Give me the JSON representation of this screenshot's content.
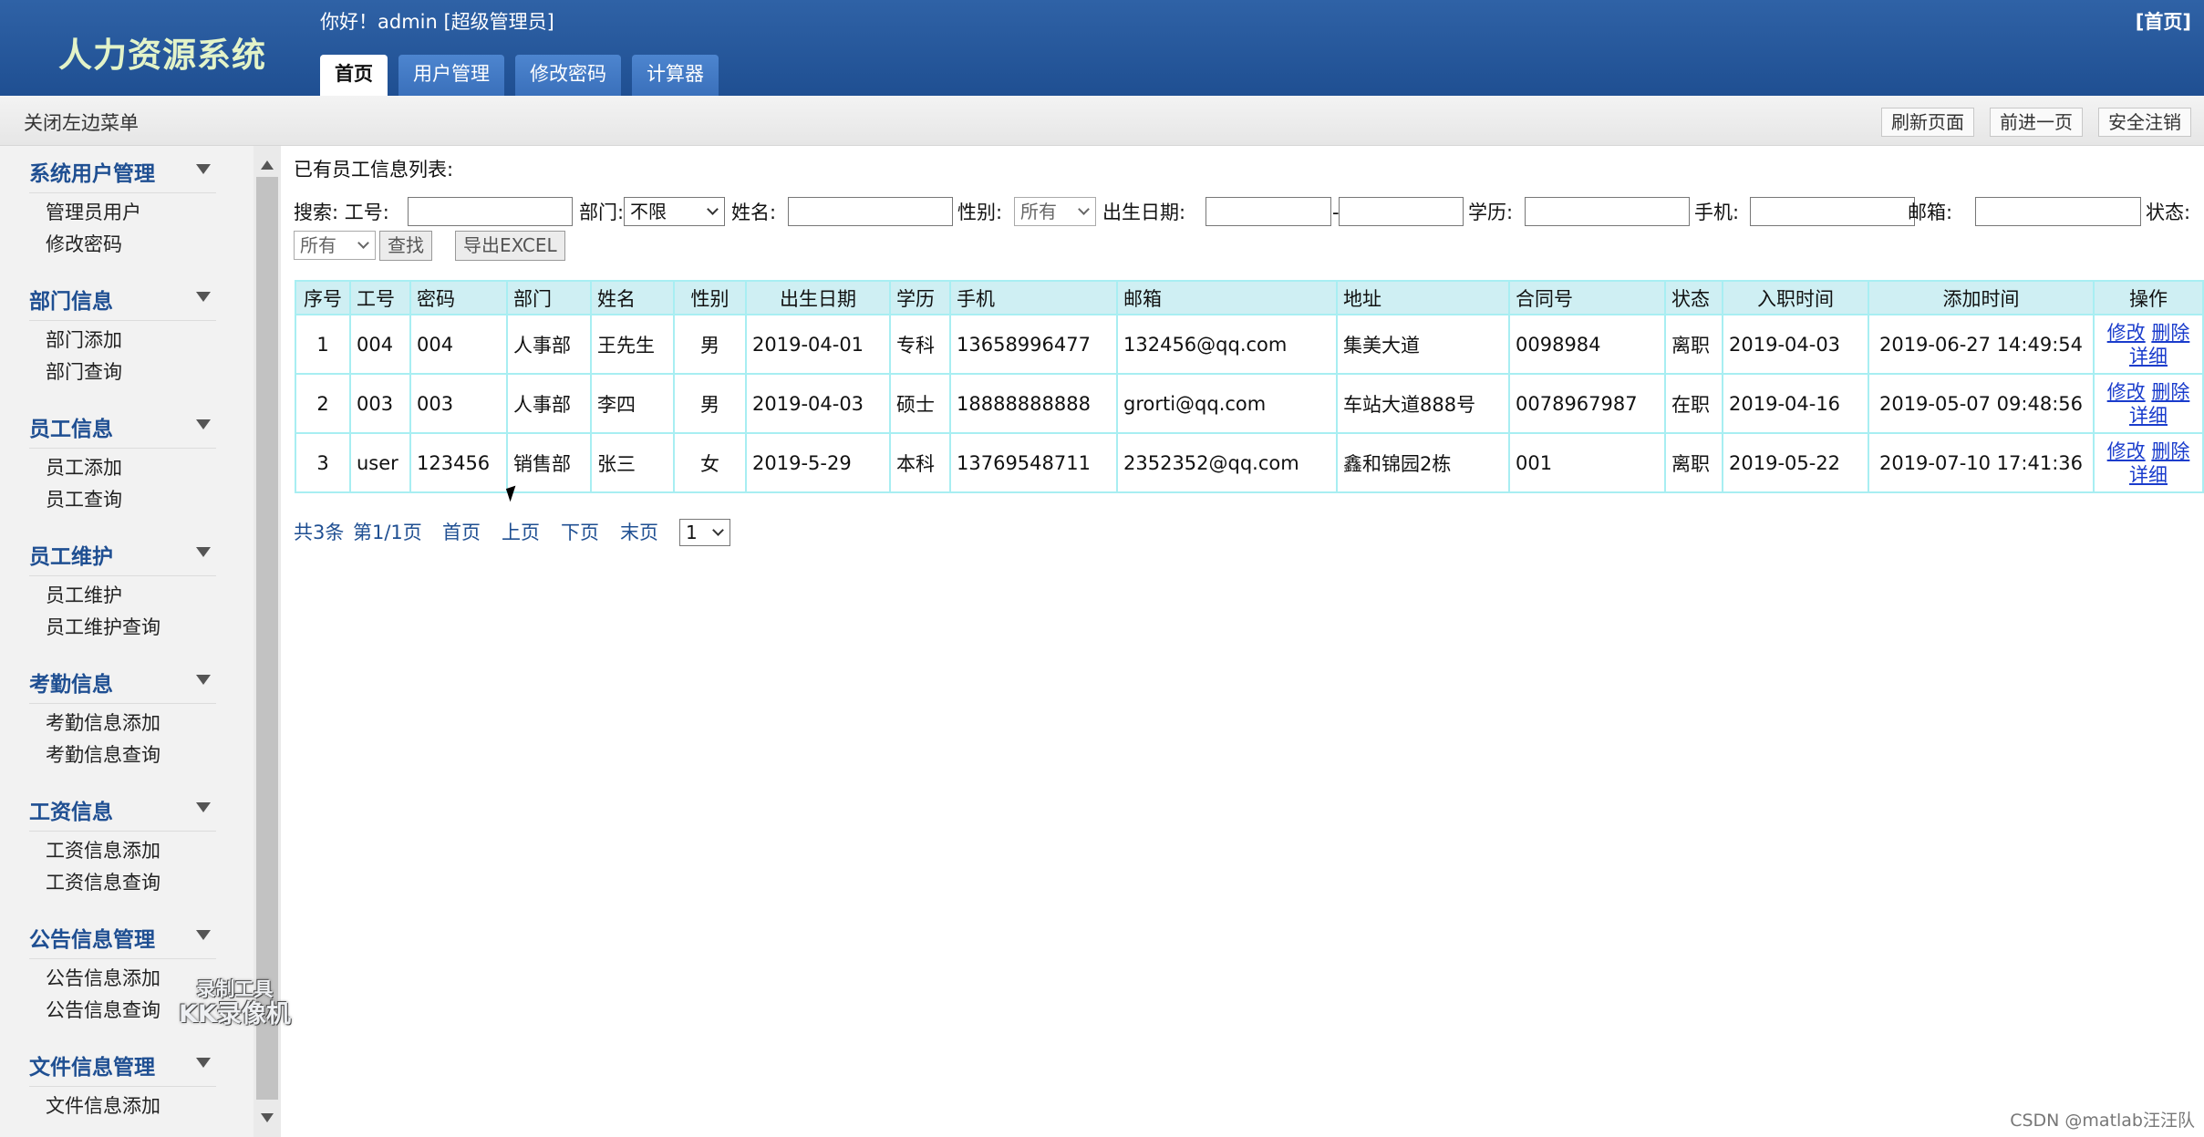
{
  "header": {
    "app_title": "人力资源系统",
    "greeting": "你好！admin [超级管理员]",
    "home_link": "[首页]",
    "tabs": [
      {
        "label": "首页"
      },
      {
        "label": "用户管理"
      },
      {
        "label": "修改密码"
      },
      {
        "label": "计算器"
      }
    ]
  },
  "toolbar": {
    "close_menu": "关闭左边菜单",
    "refresh": "刷新页面",
    "forward": "前进一页",
    "logout": "安全注销"
  },
  "sidebar": {
    "groups": [
      {
        "title": "系统用户管理",
        "items": [
          "管理员用户",
          "修改密码"
        ]
      },
      {
        "title": "部门信息",
        "items": [
          "部门添加",
          "部门查询"
        ]
      },
      {
        "title": "员工信息",
        "items": [
          "员工添加",
          "员工查询"
        ]
      },
      {
        "title": "员工维护",
        "items": [
          "员工维护",
          "员工维护查询"
        ]
      },
      {
        "title": "考勤信息",
        "items": [
          "考勤信息添加",
          "考勤信息查询"
        ]
      },
      {
        "title": "工资信息",
        "items": [
          "工资信息添加",
          "工资信息查询"
        ]
      },
      {
        "title": "公告信息管理",
        "items": [
          "公告信息添加",
          "公告信息查询"
        ]
      },
      {
        "title": "文件信息管理",
        "items": [
          "文件信息添加"
        ]
      }
    ]
  },
  "main": {
    "list_title": "已有员工信息列表:",
    "search": {
      "prefix": "搜索: 工号:",
      "dept_label": "部门:",
      "dept_value": "不限",
      "name_label": "姓名:",
      "gender_label": "性别:",
      "gender_value": "所有",
      "birth_label": "出生日期:",
      "birth_sep": "-",
      "edu_label": "学历:",
      "phone_label": "手机:",
      "email_label": "邮箱:",
      "status_label": "状态:",
      "status_value": "所有",
      "search_btn": "查找",
      "export_btn": "导出EXCEL"
    },
    "table": {
      "headers": [
        "序号",
        "工号",
        "密码",
        "部门",
        "姓名",
        "性别",
        "出生日期",
        "学历",
        "手机",
        "邮箱",
        "地址",
        "合同号",
        "状态",
        "入职时间",
        "添加时间",
        "操作"
      ],
      "rows": [
        {
          "no": "1",
          "id": "004",
          "pwd": "004",
          "dept": "人事部",
          "name": "王先生",
          "gender": "男",
          "birth": "2019-04-01",
          "edu": "专科",
          "phone": "13658996477",
          "email": "132456@qq.com",
          "addr": "集美大道",
          "contract": "0098984",
          "status": "离职",
          "join": "2019-04-03",
          "added": "2019-06-27 14:49:54"
        },
        {
          "no": "2",
          "id": "003",
          "pwd": "003",
          "dept": "人事部",
          "name": "李四",
          "gender": "男",
          "birth": "2019-04-03",
          "edu": "硕士",
          "phone": "18888888888",
          "email": "grorti@qq.com",
          "addr": "车站大道888号",
          "contract": "0078967987",
          "status": "在职",
          "join": "2019-04-16",
          "added": "2019-05-07 09:48:56"
        },
        {
          "no": "3",
          "id": "user",
          "pwd": "123456",
          "dept": "销售部",
          "name": "张三",
          "gender": "女",
          "birth": "2019-5-29",
          "edu": "本科",
          "phone": "13769548711",
          "email": "2352352@qq.com",
          "addr": "鑫和锦园2栋",
          "contract": "001",
          "status": "离职",
          "join": "2019-05-22",
          "added": "2019-07-10 17:41:36"
        }
      ],
      "ops": {
        "edit": "修改",
        "delete": "删除",
        "detail": "详细"
      }
    },
    "pager": {
      "total": "共3条",
      "page": "第1/1页",
      "first": "首页",
      "prev": "上页",
      "next": "下页",
      "last": "末页",
      "current": "1"
    }
  },
  "overlay": {
    "rec_line1": "录制工具",
    "rec_line2": "KK录像机",
    "credit": "CSDN @matlab汪汪队"
  },
  "colors": {
    "header_blue": "#2f62a6",
    "title_green": "#e3f3c8",
    "menu_title_blue": "#1f4f92",
    "table_border": "#a8eef2",
    "table_header_bg": "#cfeff3",
    "link_blue": "#1a3ccc"
  }
}
